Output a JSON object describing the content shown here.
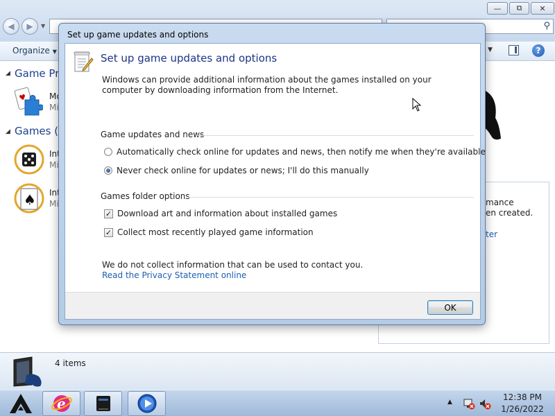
{
  "explorer": {
    "toolbar": {
      "organize_label": "Organize"
    },
    "groups": [
      {
        "title": "Game Pro"
      },
      {
        "title": "Games (3"
      }
    ],
    "items": [
      {
        "line1": "Mo",
        "line2": "Mi"
      },
      {
        "line1": "Int",
        "line2": "Mi"
      },
      {
        "line1": "Int",
        "line2": "Mi"
      }
    ],
    "right_panel": {
      "text1": "mance",
      "text2": "en created.",
      "link": "ter"
    },
    "status": {
      "count_text": "4 items"
    }
  },
  "taskbar": {
    "clock_time": "12:38 PM",
    "clock_date": "1/26/2022"
  },
  "dialog": {
    "title": "Set up game updates and options",
    "heading": "Set up game updates and options",
    "description": "Windows can provide additional information about the games installed on your computer by downloading information from the Internet.",
    "updates_section": {
      "label": "Game updates and news",
      "options": [
        {
          "label": "Automatically check online for updates and news, then notify me when they're available",
          "selected": false
        },
        {
          "label": "Never check online for updates or news; I'll do this manually",
          "selected": true
        }
      ]
    },
    "folder_section": {
      "label": "Games folder options",
      "options": [
        {
          "label": "Download art and information about installed games",
          "checked": true
        },
        {
          "label": "Collect most recently played game information",
          "checked": true
        }
      ]
    },
    "note": "We do not collect information that can be used to contact you.",
    "privacy_link": "Read the Privacy Statement online",
    "ok_label": "OK"
  },
  "colors": {
    "heading": "#1e3287",
    "link": "#1a5fb4",
    "group_title": "#1e3f8f"
  }
}
